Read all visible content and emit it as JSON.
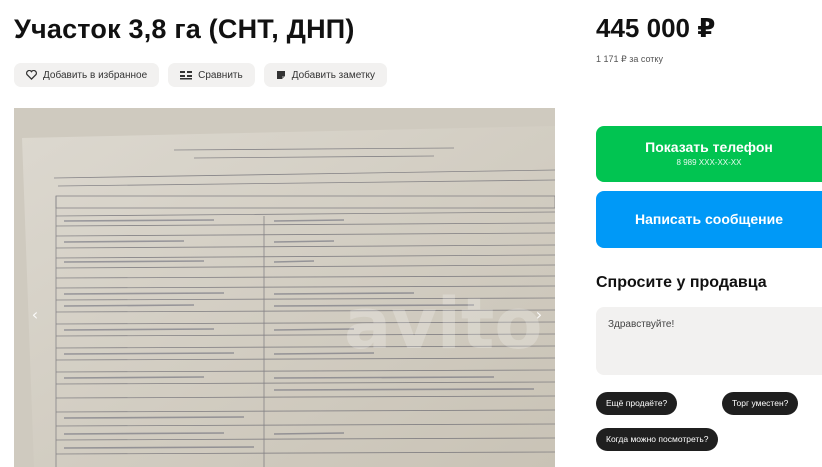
{
  "listing": {
    "title": "Участок 3,8 га (СНТ, ДНП)",
    "price": "445 000 ₽",
    "price_per": "1 171 ₽ за сотку"
  },
  "actions": {
    "favorite_label": "Добавить в избранное",
    "compare_label": "Сравнить",
    "note_label": "Добавить заметку"
  },
  "gallery": {
    "prev_icon": "chevron-left-icon",
    "next_icon": "chevron-right-icon"
  },
  "contact": {
    "phone_label": "Показать телефон",
    "phone_masked": "8 989 XXX-XX-XX",
    "message_label": "Написать сообщение"
  },
  "ask_seller": {
    "title": "Спросите у продавца",
    "placeholder": "Здравствуйте!",
    "chips": [
      "Ещё продаёте?",
      "Торг уместен?",
      "Когда можно посмотреть?"
    ]
  },
  "colors": {
    "phone_button": "#01c451",
    "message_button": "#0099f7",
    "chip": "#1f1f1f"
  }
}
